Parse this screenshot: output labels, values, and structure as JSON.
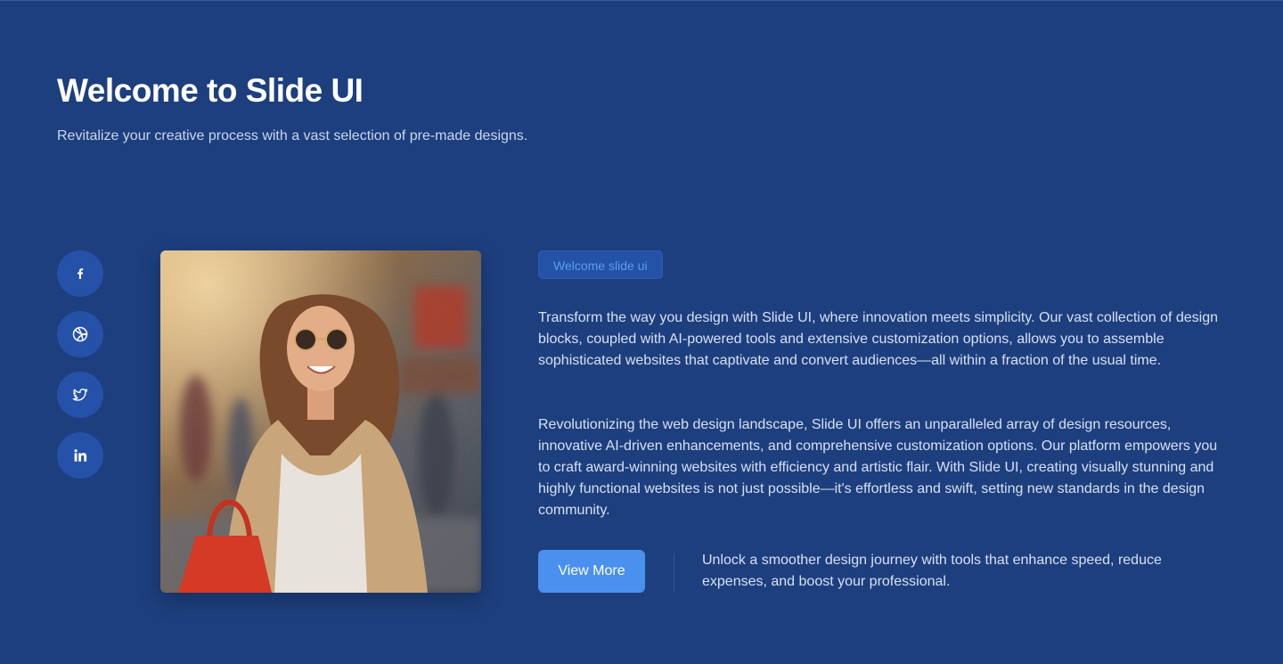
{
  "hero": {
    "title": "Welcome to Slide UI",
    "subtitle": "Revitalize your creative process with a vast selection of pre-made designs."
  },
  "socials": [
    {
      "icon": "facebook-icon"
    },
    {
      "icon": "dribbble-icon"
    },
    {
      "icon": "twitter-icon"
    },
    {
      "icon": "linkedin-icon"
    }
  ],
  "content": {
    "badge": "Welcome slide ui",
    "paragraph1": "Transform the way you design with Slide UI, where innovation meets simplicity. Our vast collection of design blocks, coupled with AI-powered tools and extensive customization options, allows you to assemble sophisticated websites that captivate and convert audiences—all within a fraction of the usual time.",
    "paragraph2": "Revolutionizing the web design landscape, Slide UI offers an unparalleled array of design resources, innovative AI-driven enhancements, and comprehensive customization options. Our platform empowers you to craft award-winning websites with efficiency and artistic flair. With Slide UI, creating visually stunning and highly functional websites is not just possible—it's effortless and swift, setting new standards in the design community.",
    "cta_label": "View More",
    "cta_note": "Unlock a smoother design journey with tools that enhance speed, reduce expenses, and boost your professional."
  },
  "colors": {
    "background": "#1d3f7e",
    "accent": "#4a90ee",
    "social_bg": "#2552a8",
    "badge_text": "#5b9cf0"
  }
}
